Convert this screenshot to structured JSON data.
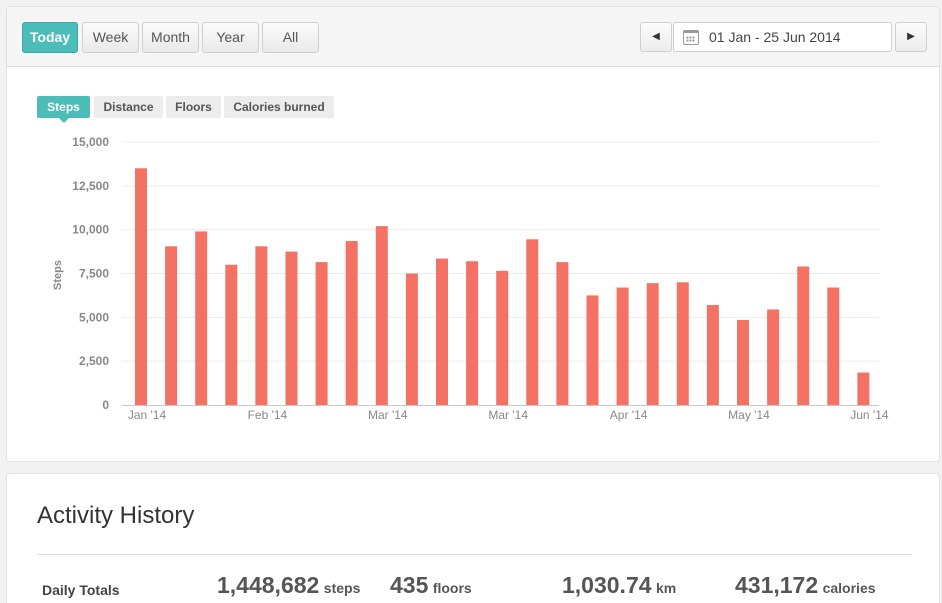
{
  "toolbar": {
    "range_buttons": [
      "Today",
      "Week",
      "Month",
      "Year",
      "All"
    ],
    "active_range": "Today",
    "date_range": "01 Jan - 25 Jun 2014",
    "prev_icon": "caret-left-icon",
    "next_icon": "caret-right-icon",
    "calendar_icon": "calendar-icon"
  },
  "metric_tabs": [
    "Steps",
    "Distance",
    "Floors",
    "Calories burned"
  ],
  "active_metric": "Steps",
  "colors": {
    "accent": "#4dbdb9",
    "bar": "#f47264"
  },
  "chart_data": {
    "type": "bar",
    "ylabel": "Steps",
    "ylim": [
      0,
      15000
    ],
    "yticks": [
      "0",
      "2,500",
      "5,000",
      "7,500",
      "10,000",
      "12,500",
      "15,000"
    ],
    "xtick_labels": [
      {
        "label": "Jan '14",
        "index": 0
      },
      {
        "label": "Feb '14",
        "index": 4
      },
      {
        "label": "Mar '14",
        "index": 8
      },
      {
        "label": "Mar '14",
        "index": 12
      },
      {
        "label": "Apr '14",
        "index": 16
      },
      {
        "label": "May '14",
        "index": 20
      },
      {
        "label": "Jun '14",
        "index": 24
      }
    ],
    "values": [
      13500,
      9050,
      9900,
      8000,
      9050,
      8750,
      8150,
      9350,
      10200,
      7500,
      8350,
      8200,
      7650,
      9450,
      8150,
      6250,
      6700,
      6950,
      7000,
      5700,
      4850,
      5450,
      7900,
      6700,
      1850
    ],
    "grid": true
  },
  "activity_history": {
    "title": "Activity History",
    "row_label": "Daily Totals",
    "totals": [
      {
        "value": "1,448,682",
        "unit": "steps"
      },
      {
        "value": "435",
        "unit": "floors"
      },
      {
        "value": "1,030.74",
        "unit": "km"
      },
      {
        "value": "431,172",
        "unit": "calories"
      }
    ]
  }
}
